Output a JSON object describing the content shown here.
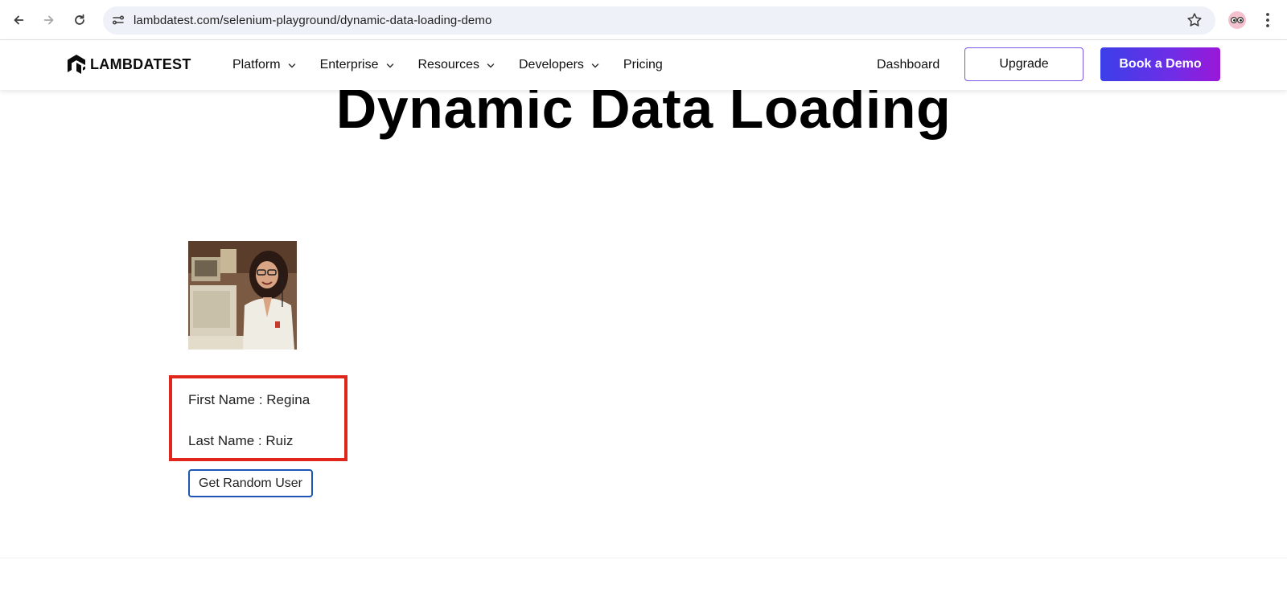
{
  "browser": {
    "url": "lambdatest.com/selenium-playground/dynamic-data-loading-demo",
    "icons": [
      "back-arrow-icon",
      "forward-arrow-icon",
      "reload-icon",
      "site-settings-icon",
      "bookmark-star-icon",
      "profile-avatar-icon",
      "more-menu-icon"
    ]
  },
  "header": {
    "logo_text": "LAMBDATEST",
    "menu": [
      {
        "label": "Platform",
        "dropdown": true
      },
      {
        "label": "Enterprise",
        "dropdown": true
      },
      {
        "label": "Resources",
        "dropdown": true
      },
      {
        "label": "Developers",
        "dropdown": true
      },
      {
        "label": "Pricing",
        "dropdown": false
      }
    ],
    "dashboard_label": "Dashboard",
    "upgrade_label": "Upgrade",
    "demo_label": "Book a Demo",
    "colors": {
      "upgrade_border": "#7b53e6",
      "demo_gradient_start": "#3b3fe8",
      "demo_gradient_end": "#9b17d8"
    }
  },
  "main": {
    "title": "Dynamic Data Loading",
    "first_name": "First Name : Regina",
    "last_name": "Last Name : Ruiz",
    "button_label": "Get Random User",
    "highlight_color": "#e0261b"
  }
}
